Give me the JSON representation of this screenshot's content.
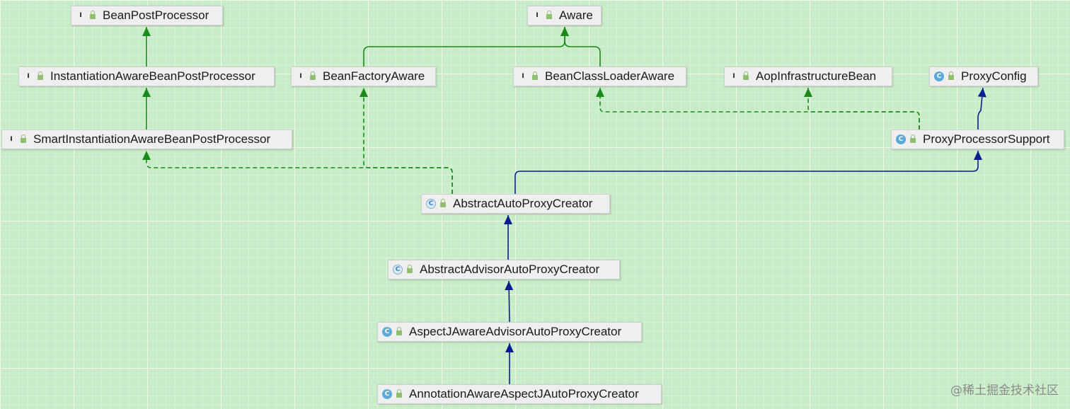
{
  "nodes": {
    "bean_post_processor": {
      "label": "BeanPostProcessor",
      "kind": "interface",
      "kind_letter": "I"
    },
    "aware": {
      "label": "Aware",
      "kind": "interface",
      "kind_letter": "I"
    },
    "instantiation_aware_bean_post_processor": {
      "label": "InstantiationAwareBeanPostProcessor",
      "kind": "interface",
      "kind_letter": "I"
    },
    "bean_factory_aware": {
      "label": "BeanFactoryAware",
      "kind": "interface",
      "kind_letter": "I"
    },
    "bean_class_loader_aware": {
      "label": "BeanClassLoaderAware",
      "kind": "interface",
      "kind_letter": "I"
    },
    "aop_infrastructure_bean": {
      "label": "AopInfrastructureBean",
      "kind": "interface",
      "kind_letter": "I"
    },
    "proxy_config": {
      "label": "ProxyConfig",
      "kind": "class",
      "kind_letter": "C"
    },
    "smart_instantiation_aware_bean_post_processor": {
      "label": "SmartInstantiationAwareBeanPostProcessor",
      "kind": "interface",
      "kind_letter": "I"
    },
    "proxy_processor_support": {
      "label": "ProxyProcessorSupport",
      "kind": "class",
      "kind_letter": "C"
    },
    "abstract_auto_proxy_creator": {
      "label": "AbstractAutoProxyCreator",
      "kind": "abstract",
      "kind_letter": "C"
    },
    "abstract_advisor_auto_proxy_creator": {
      "label": "AbstractAdvisorAutoProxyCreator",
      "kind": "abstract",
      "kind_letter": "C"
    },
    "aspectj_aware_advisor_auto_proxy_creator": {
      "label": "AspectJAwareAdvisorAutoProxyCreator",
      "kind": "class",
      "kind_letter": "C"
    },
    "annotation_aware_aspectj_auto_proxy_creator": {
      "label": "AnnotationAwareAspectJAutoProxyCreator",
      "kind": "class",
      "kind_letter": "C"
    }
  },
  "edges": [
    {
      "from": "instantiation_aware_bean_post_processor",
      "to": "bean_post_processor",
      "relation": "extends-interface"
    },
    {
      "from": "bean_factory_aware",
      "to": "aware",
      "relation": "extends-interface"
    },
    {
      "from": "bean_class_loader_aware",
      "to": "aware",
      "relation": "extends-interface"
    },
    {
      "from": "smart_instantiation_aware_bean_post_processor",
      "to": "instantiation_aware_bean_post_processor",
      "relation": "extends-interface"
    },
    {
      "from": "proxy_processor_support",
      "to": "proxy_config",
      "relation": "extends-class"
    },
    {
      "from": "proxy_processor_support",
      "to": "bean_class_loader_aware",
      "relation": "implements"
    },
    {
      "from": "proxy_processor_support",
      "to": "aop_infrastructure_bean",
      "relation": "implements"
    },
    {
      "from": "abstract_auto_proxy_creator",
      "to": "smart_instantiation_aware_bean_post_processor",
      "relation": "implements"
    },
    {
      "from": "abstract_auto_proxy_creator",
      "to": "bean_factory_aware",
      "relation": "implements"
    },
    {
      "from": "abstract_auto_proxy_creator",
      "to": "proxy_processor_support",
      "relation": "extends-class"
    },
    {
      "from": "abstract_advisor_auto_proxy_creator",
      "to": "abstract_auto_proxy_creator",
      "relation": "extends-class"
    },
    {
      "from": "aspectj_aware_advisor_auto_proxy_creator",
      "to": "abstract_advisor_auto_proxy_creator",
      "relation": "extends-class"
    },
    {
      "from": "annotation_aware_aspectj_auto_proxy_creator",
      "to": "aspectj_aware_advisor_auto_proxy_creator",
      "relation": "extends-class"
    }
  ],
  "colors": {
    "background": "#c8ecc8",
    "interface_edge": "#1a8a1a",
    "class_edge": "#0a1f8f"
  },
  "watermark": "@稀土掘金技术社区"
}
